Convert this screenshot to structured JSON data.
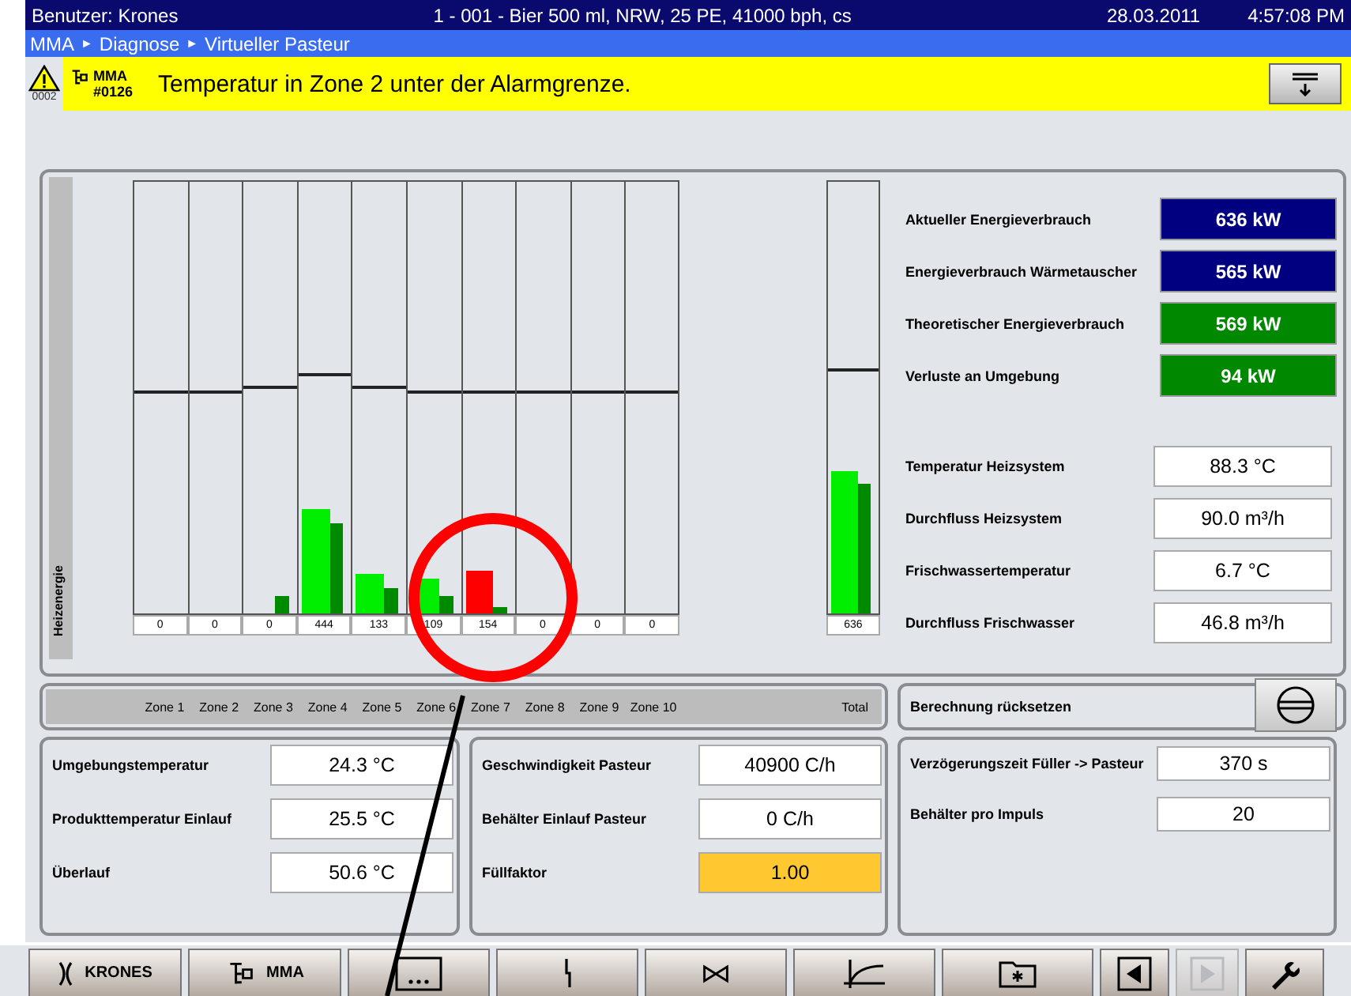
{
  "title_bar": {
    "user": "Benutzer: Krones",
    "recipe": "1 - 001 - Bier 500 ml, NRW, 25 PE, 41000 bph, cs",
    "date": "28.03.2011",
    "time": "4:57:08 PM"
  },
  "breadcrumb": [
    "MMA",
    "Diagnose",
    "Virtueller Pasteur"
  ],
  "breadcrumb_separator": "►",
  "alarm": {
    "count": "0002",
    "source": "MMA",
    "code": "#0126",
    "message": "Temperatur in Zone 2 unter der Alarmgrenze."
  },
  "energy_chart": {
    "axis_label": "Heizenergie",
    "zones": [
      {
        "label": "Zone 1",
        "reading": "0",
        "limit": {
          "level": 0.51
        }
      },
      {
        "label": "Zone 2",
        "reading": "0",
        "limit": {
          "level": 0.51
        }
      },
      {
        "label": "Zone 3",
        "reading": "0",
        "target": {
          "level": 0.04
        },
        "limit": {
          "level": 0.52
        }
      },
      {
        "label": "Zone 4",
        "reading": "444",
        "alarm": false,
        "actual": {
          "level": 0.24
        },
        "target": {
          "level": 0.21
        },
        "limit": {
          "level": 0.55
        }
      },
      {
        "label": "Zone 5",
        "reading": "133",
        "alarm": false,
        "actual": {
          "level": 0.09
        },
        "target": {
          "level": 0.06
        },
        "limit": {
          "level": 0.52
        }
      },
      {
        "label": "Zone 6",
        "reading": "109",
        "alarm": false,
        "actual": {
          "level": 0.08
        },
        "target": {
          "level": 0.04
        },
        "limit": {
          "level": 0.51
        }
      },
      {
        "label": "Zone 7",
        "reading": "154",
        "alarm": true,
        "actual": {
          "level": 0.1
        },
        "target": {
          "level": 0.015
        },
        "limit": {
          "level": 0.51
        }
      },
      {
        "label": "Zone 8",
        "reading": "0",
        "limit": {
          "level": 0.51
        }
      },
      {
        "label": "Zone 9",
        "reading": "0",
        "limit": {
          "level": 0.51
        }
      },
      {
        "label": "Zone 10",
        "reading": "0",
        "limit": {
          "level": 0.51
        }
      }
    ],
    "total": {
      "label": "Total",
      "reading": "636",
      "alarm": false,
      "actual": {
        "level": 0.33
      },
      "target": {
        "level": 0.3
      },
      "limit": {
        "level": 0.56
      }
    }
  },
  "energy": [
    {
      "label": "Aktueller Energieverbrauch",
      "value": "636 kW",
      "color": "#000080"
    },
    {
      "label": "Energieverbrauch Wärmetauscher",
      "value": "565 kW",
      "color": "#000080"
    },
    {
      "label": "Theoretischer Energieverbrauch",
      "value": "569 kW",
      "color": "#008800"
    },
    {
      "label": "Verluste an Umgebung",
      "value": "94 kW",
      "color": "#008800"
    }
  ],
  "measurements": [
    {
      "label": "Temperatur Heizsystem",
      "value": "88.3 °C"
    },
    {
      "label": "Durchfluss Heizsystem",
      "value": "90.0 m³/h"
    },
    {
      "label": "Frischwassertemperatur",
      "value": "6.7 °C"
    },
    {
      "label": "Durchfluss Frischwasser",
      "value": "46.8 m³/h"
    }
  ],
  "reset": {
    "label": "Berechnung rücksetzen"
  },
  "parameter_panels": [
    [
      {
        "label": "Umgebungstemperatur",
        "value": "24.3 °C",
        "alert": false
      },
      {
        "label": "Produkttemperatur Einlauf",
        "value": "25.5 °C",
        "alert": false
      },
      {
        "label": "Überlauf",
        "value": "50.6 °C",
        "alert": false
      }
    ],
    [
      {
        "label": "Geschwindigkeit Pasteur",
        "value": "40900 C/h",
        "alert": false
      },
      {
        "label": "Behälter Einlauf Pasteur",
        "value": "0 C/h",
        "alert": false
      },
      {
        "label": "Füllfaktor",
        "value": "1.00",
        "alert": true
      }
    ],
    [
      {
        "label": "Verzögerungszeit Füller -> Pasteur",
        "value": "370 s",
        "alert": false
      },
      {
        "label": "Behälter pro Impuls",
        "value": "20",
        "alert": false
      }
    ]
  ],
  "toolbar": [
    {
      "kind": "krones",
      "label": "KRONES",
      "disabled": false
    },
    {
      "kind": "tree",
      "label": "MMA",
      "disabled": false
    },
    {
      "kind": "dots",
      "disabled": false
    },
    {
      "kind": "signal",
      "disabled": false
    },
    {
      "kind": "valve",
      "disabled": false
    },
    {
      "kind": "curve",
      "disabled": false
    },
    {
      "kind": "folder",
      "disabled": false
    },
    {
      "kind": "prev",
      "disabled": false
    },
    {
      "kind": "next",
      "disabled": true
    },
    {
      "kind": "wrench",
      "disabled": false
    }
  ]
}
